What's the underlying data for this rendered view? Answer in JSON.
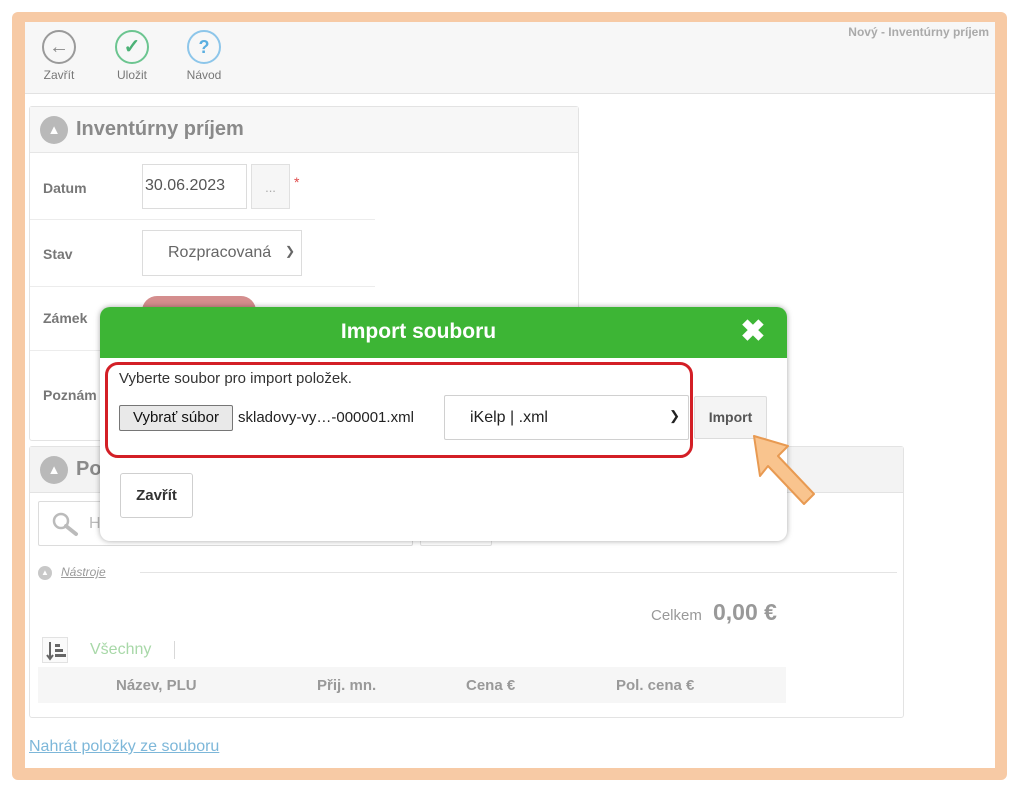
{
  "toolbar": {
    "close_label": "Zavřít",
    "save_label": "Uložit",
    "help_label": "Návod",
    "close_icon": "arrow-left-circle",
    "save_icon": "check-circle",
    "help_icon": "question-circle"
  },
  "page_title": "Nový - Inventúrny príjem",
  "form": {
    "title": "Inventúrny príjem",
    "date_label": "Datum",
    "date_value": "30.06.2023",
    "date_picker_label": "...",
    "required_mark": "*",
    "status_label": "Stav",
    "status_value": "Rozpracovaná",
    "lock_label": "Zámek",
    "note_label": "Poznám"
  },
  "items": {
    "title": "Po",
    "search_placeholder": "H",
    "tools_label": "Nástroje",
    "total_label": "Celkem",
    "total_value": "0,00 €",
    "filter_all": "Všechny",
    "columns": [
      "Název, PLU",
      "Přij. mn.",
      "Cena €",
      "Pol. cena €"
    ]
  },
  "bottom_link": "Nahrát položky ze souboru",
  "dialog": {
    "title": "Import souboru",
    "instruction": "Vyberte soubor pro import položek.",
    "file_button": "Vybrať súbor",
    "file_name": "skladovy-vy…-000001.xml",
    "format_value": "iKelp | .xml",
    "import_button": "Import",
    "close_button": "Zavřít"
  },
  "colors": {
    "dialog_header": "#3db535",
    "highlight_border": "#d31f26",
    "frame": "#f7caa5",
    "pointer": "#f9c48e"
  }
}
